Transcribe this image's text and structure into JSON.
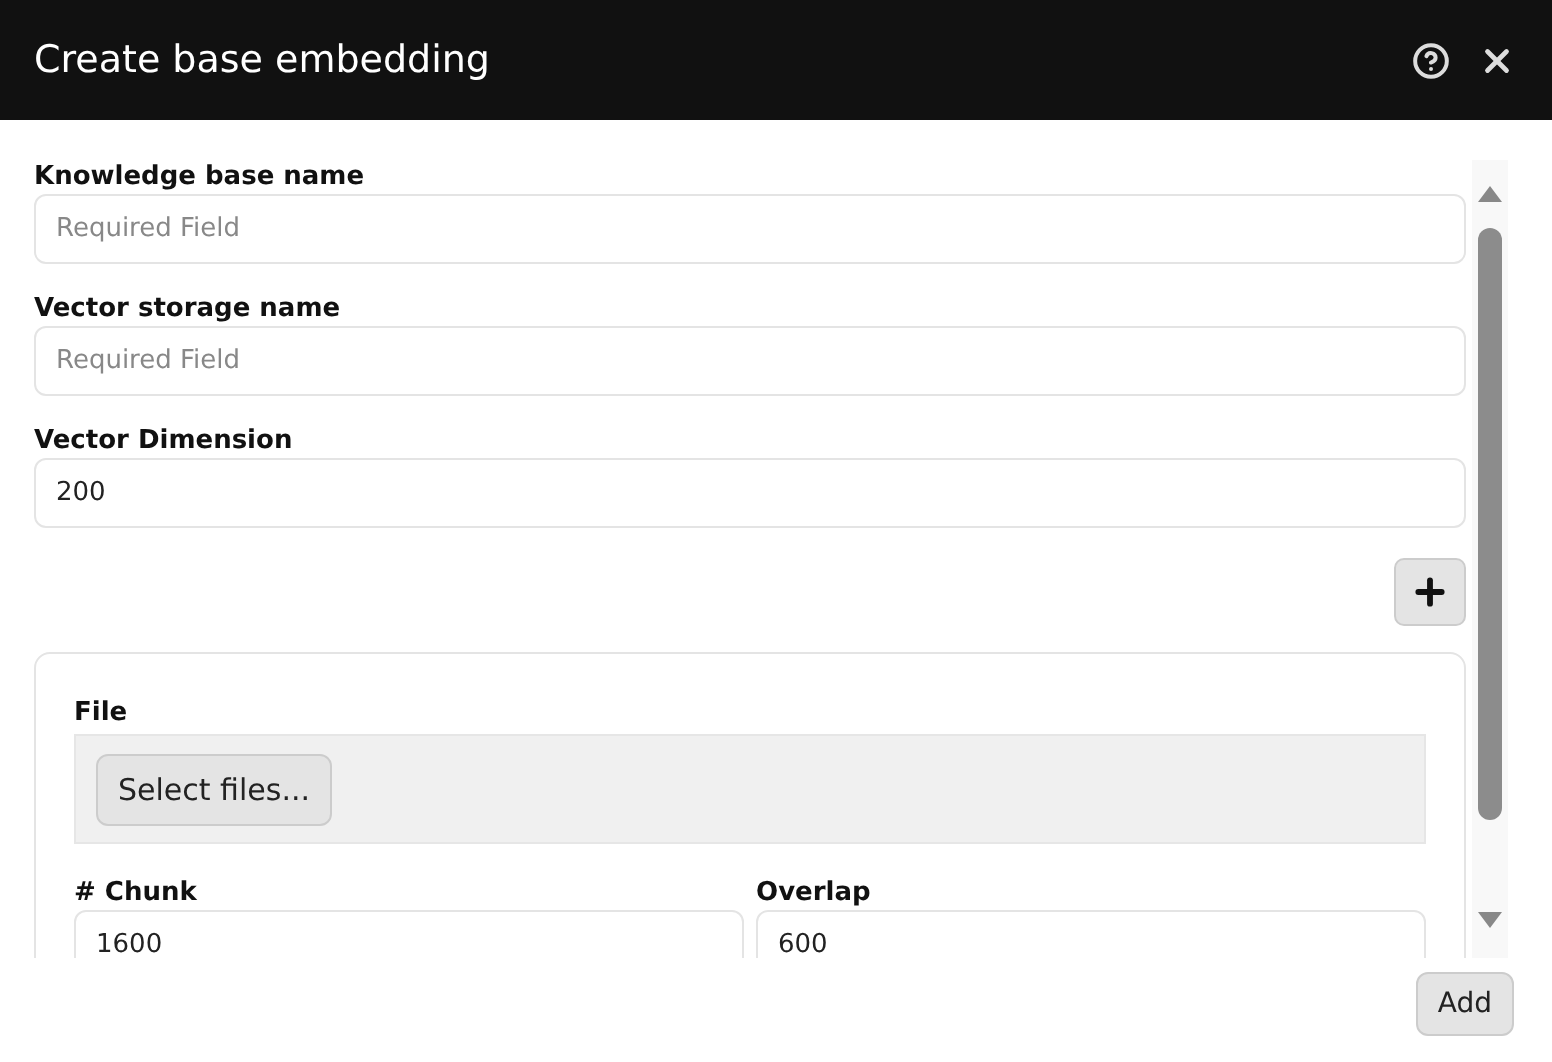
{
  "dialog": {
    "title": "Create base embedding"
  },
  "fields": [
    {
      "label": "Knowledge base name",
      "placeholder": "Required Field"
    },
    {
      "label": "Vector storage name",
      "placeholder": "Required Field"
    },
    {
      "label": "Vector Dimension",
      "value": "200"
    }
  ],
  "source": {
    "file_label": "File",
    "select_button": "Select files...",
    "params": [
      {
        "label": "# Chunk",
        "value": "1600"
      },
      {
        "label": "Overlap",
        "value": "600"
      }
    ]
  },
  "footer": {
    "add_button": "Add"
  }
}
